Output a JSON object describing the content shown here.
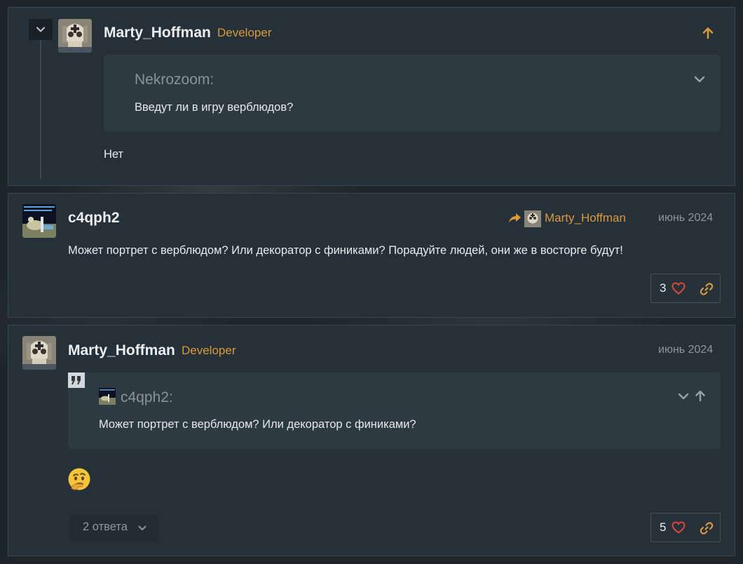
{
  "colors": {
    "accent": "#d99a3e",
    "heart": "#e0463c",
    "background": "#1e262b",
    "post_bg": "#253038",
    "quote_bg": "#2e3a42"
  },
  "post1": {
    "username": "Marty_Hoffman",
    "role": "Developer",
    "quote": {
      "author": "Nekrozoom:",
      "text": "Введут ли в игру верблюдов?"
    },
    "body": "Нет",
    "icons": [
      "chevron-down-icon",
      "arrow-up-icon",
      "chevron-down-icon"
    ]
  },
  "post2": {
    "username": "c4qph2",
    "reply_to": "Marty_Hoffman",
    "date": "июнь 2024",
    "body": "Может портрет с верблюдом? Или декоратор с финиками? Порадуйте людей, они же в восторге будут!",
    "likes": "3",
    "icons": [
      "reply-arrow-icon",
      "heart-icon",
      "link-icon"
    ]
  },
  "post3": {
    "username": "Marty_Hoffman",
    "role": "Developer",
    "date": "июнь 2024",
    "quote": {
      "author": "c4qph2:",
      "text": "Может портрет с верблюдом? Или декоратор с финиками?"
    },
    "emoji": "🤔",
    "replies_label": "2 ответа",
    "likes": "5",
    "icons": [
      "quote-icon",
      "chevron-down-icon",
      "arrow-up-icon",
      "heart-icon",
      "link-icon"
    ]
  }
}
